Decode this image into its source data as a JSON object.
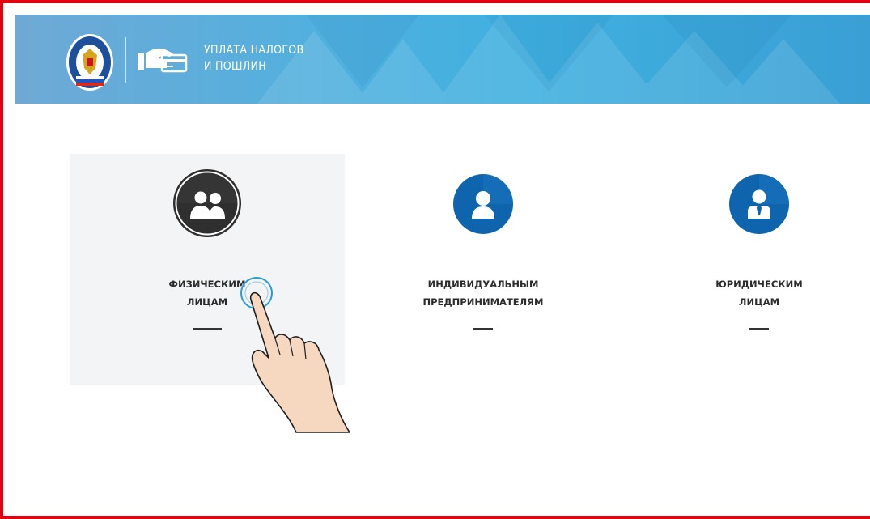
{
  "header": {
    "title_line1": "УПЛАТА НАЛОГОВ",
    "title_line2": "И ПОШЛИН"
  },
  "cards": [
    {
      "line1": "ФИЗИЧЕСКИМ",
      "line2": "ЛИЦАМ",
      "icon": "users-group-icon",
      "active": true
    },
    {
      "line1": "ИНДИВИДУАЛЬНЫМ",
      "line2": "ПРЕДПРИНИМАТЕЛЯМ",
      "icon": "user-icon",
      "active": false
    },
    {
      "line1": "ЮРИДИЧЕСКИМ",
      "line2": "ЛИЦАМ",
      "icon": "businessman-icon",
      "active": false
    }
  ],
  "colors": {
    "frame": "#e3000f",
    "header": "#3fb0e0",
    "active_circle": "#2f2f2f",
    "circle_blue": "#0f64ae",
    "card_bg": "#f3f4f5"
  }
}
